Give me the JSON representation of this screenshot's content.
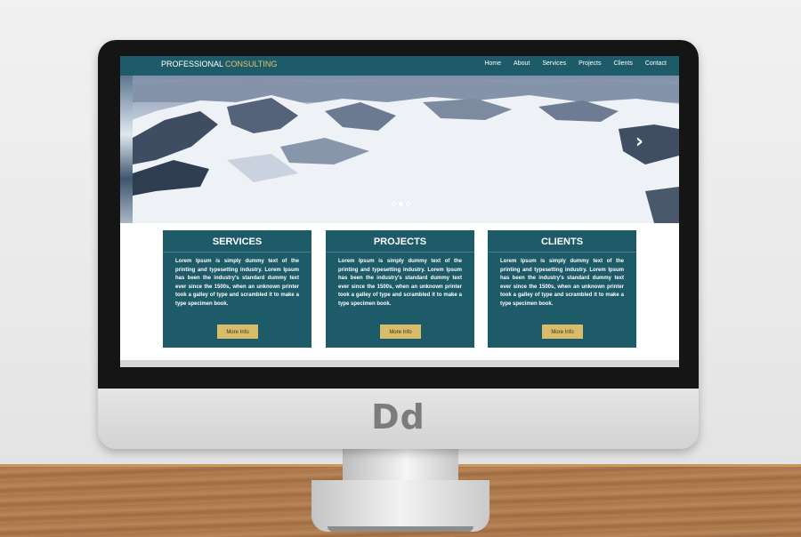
{
  "header": {
    "logo_main": "PROFESSIONAL",
    "logo_accent": "CONSULTING",
    "nav": [
      "Home",
      "About",
      "Services",
      "Projects",
      "Clients",
      "Contact"
    ]
  },
  "hero": {
    "slides": 3,
    "active_slide": 2
  },
  "cards": [
    {
      "title": "SERVICES",
      "text": "Lorem Ipsum is simply dummy text of the printing and typesetting industry. Lorem Ipsum has been the industry's standard dummy text ever since the 1500s, when an unknown printer took a galley of type and scrambled it to make a type specimen book.",
      "button": "More Info"
    },
    {
      "title": "PROJECTS",
      "text": "Lorem Ipsum is simply dummy text of the printing and typesetting industry. Lorem Ipsum has been the industry's standard dummy text ever since the 1500s, when an unknown printer took a galley of type and scrambled it to make a type specimen book.",
      "button": "More Info"
    },
    {
      "title": "CLIENTS",
      "text": "Lorem Ipsum is simply dummy text of the printing and typesetting industry. Lorem Ipsum has been the industry's standard dummy text ever since the 1500s, when an unknown printer took a galley of type and scrambled it to make a type specimen book.",
      "button": "More Info"
    }
  ],
  "monitor": {
    "brand": "Dd"
  },
  "colors": {
    "primary": "#1d5b68",
    "accent": "#e0c36d",
    "button": "#d9bc6a"
  },
  "icons": {
    "next": "chevron-right-icon"
  }
}
